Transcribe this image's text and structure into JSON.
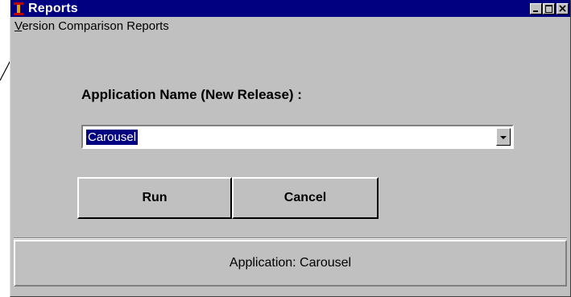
{
  "window": {
    "title": "Reports"
  },
  "menubar": {
    "item_prefix": "V",
    "item_rest": "ersion Comparison Reports"
  },
  "form": {
    "label": "Application Name (New Release) :",
    "selected_value": "Carousel"
  },
  "buttons": {
    "run": "Run",
    "cancel": "Cancel"
  },
  "status": {
    "text": "Application: Carousel"
  },
  "colors": {
    "titlebar": "#000080",
    "face": "#c0c0c0",
    "selection": "#000080"
  }
}
